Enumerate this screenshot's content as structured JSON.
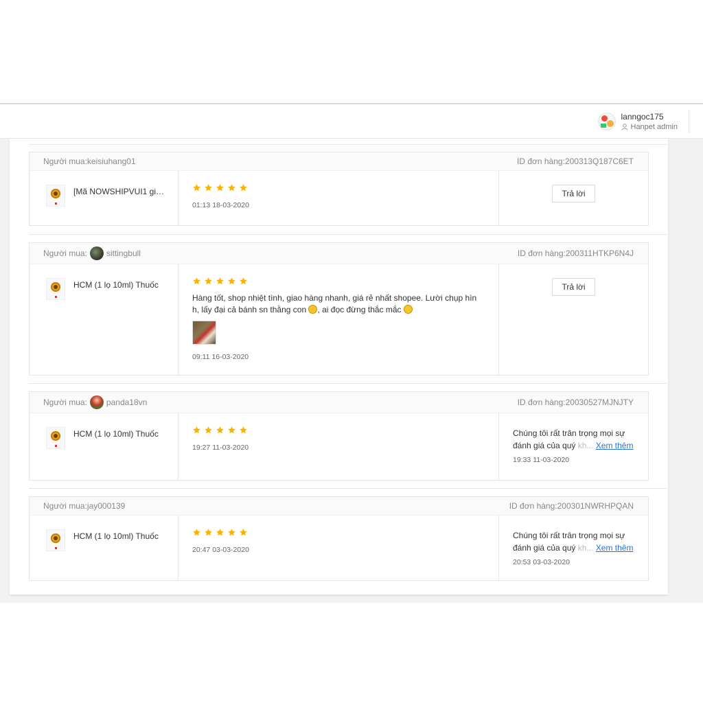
{
  "header": {
    "username": "lanngoc175",
    "role": "Hanpet admin"
  },
  "colors": {
    "star": "#f6b400",
    "link": "#2673dd"
  },
  "reviews": [
    {
      "buyer_label": "Người mua:",
      "buyer": "keisiuhang01",
      "order_label": "ID đơn hàng:",
      "order_id": "200313Q187C6ET",
      "product": "[Mã NOWSHIPVUI1 giảm",
      "rating": 5,
      "comment": "",
      "time": "01:13 18-03-2020",
      "action": "Trả lời"
    },
    {
      "buyer_label": "Người mua:",
      "buyer": "sittingbull",
      "order_label": "ID đơn hàng:",
      "order_id": "200311HTKP6N4J",
      "product": "HCM (1 lọ 10ml) Thuốc",
      "rating": 5,
      "comment_part1": "Hàng tốt, shop nhiệt tình, giao hàng nhanh, giá rẻ nhất shopee. Lười chụp hìn h, lấy đại cả bánh sn thằng con ",
      "comment_part2": ", ai đọc đừng thắc mắc ",
      "time": "09:11 16-03-2020",
      "action": "Trả lời"
    },
    {
      "buyer_label": "Người mua:",
      "buyer": "panda18vn",
      "order_label": "ID đơn hàng:",
      "order_id": "20030527MJNJTY",
      "product": "HCM (1 lọ 10ml) Thuốc",
      "rating": 5,
      "time": "19:27 11-03-2020",
      "reply_text": "Chúng tôi rất trân trọng mọi sự đánh giá của quý ",
      "reply_faded": "kh...",
      "reply_more": "Xem thêm",
      "reply_time": "19:33 11-03-2020"
    },
    {
      "buyer_label": "Người mua:",
      "buyer": "jay000139",
      "order_label": "ID đơn hàng:",
      "order_id": "200301NWRHPQAN",
      "product": "HCM (1 lọ 10ml) Thuốc",
      "rating": 5,
      "time": "20:47 03-03-2020",
      "reply_text": "Chúng tôi rất trân trọng mọi sự đánh giá của quý ",
      "reply_faded": "kh...",
      "reply_more": "Xem thêm",
      "reply_time": "20:53 03-03-2020"
    }
  ]
}
